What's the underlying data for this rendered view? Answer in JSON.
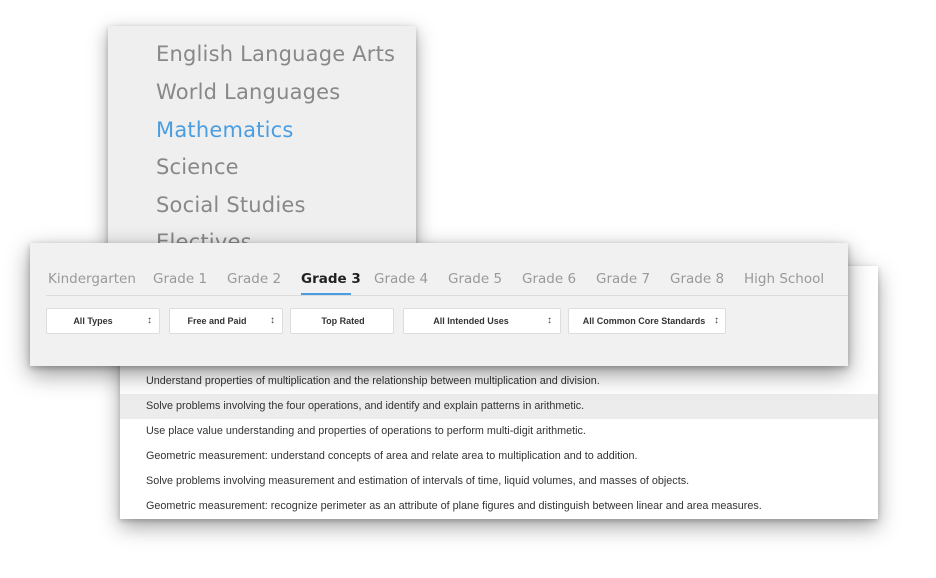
{
  "subjects": [
    {
      "label": "English Language Arts"
    },
    {
      "label": "World Languages"
    },
    {
      "label": "Mathematics"
    },
    {
      "label": "Science"
    },
    {
      "label": "Social Studies"
    },
    {
      "label": "Electives"
    }
  ],
  "grades": [
    {
      "label": "Kindergarten"
    },
    {
      "label": "Grade 1"
    },
    {
      "label": "Grade 2"
    },
    {
      "label": "Grade 3"
    },
    {
      "label": "Grade 4"
    },
    {
      "label": "Grade 5"
    },
    {
      "label": "Grade 6"
    },
    {
      "label": "Grade 7"
    },
    {
      "label": "Grade 8"
    },
    {
      "label": "High School"
    }
  ],
  "filters": {
    "types": "All Types",
    "price": "Free and Paid",
    "sort": "Top Rated",
    "uses": "All Intended Uses",
    "standards": "All Common Core Standards"
  },
  "standards": [
    "Understand properties of multiplication and the relationship between multiplication and division.",
    "Solve problems involving the four operations, and identify and explain patterns in arithmetic.",
    "Use place value understanding and properties of operations to perform multi-digit arithmetic.",
    "Geometric measurement: understand concepts of area and relate area to multiplication and to addition.",
    "Solve problems involving measurement and estimation of intervals of time, liquid volumes, and masses of objects.",
    "Geometric measurement: recognize perimeter as an attribute of plane figures and distinguish between linear and area measures."
  ],
  "colors": {
    "accent": "#4a9de0",
    "subject_text": "#888888",
    "grade_text": "#999999"
  },
  "icons": {
    "chevron": "chevron-up-down-icon"
  }
}
